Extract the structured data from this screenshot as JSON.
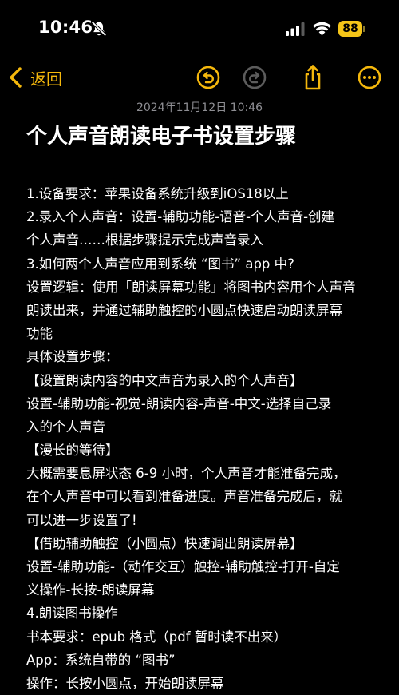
{
  "status_bar": {
    "time": "10:46",
    "battery_level": "88",
    "icons": [
      "bell-slash-icon",
      "signal-icon",
      "wifi-icon",
      "battery-icon"
    ]
  },
  "nav": {
    "back_label": "返回",
    "accent_color": "#f5b80c",
    "icons": [
      "chevron-left-icon",
      "undo-icon",
      "redo-icon",
      "share-icon",
      "more-icon"
    ]
  },
  "note": {
    "date": "2024年11月12日 10:46",
    "title": "个人声音朗读电子书设置步骤",
    "lines": [
      "1.设备要求：苹果设备系统升级到iOS18以上",
      "2.录入个人声音：设置-辅助功能-语音-个人声音-创建",
      "个人声音……根据步骤提示完成声音录入",
      "3.如何两个人声音应用到系统 “图书” app 中?",
      "设置逻辑：使用「朗读屏幕功能」将图书内容用个人声音",
      "朗读出来，并通过辅助触控的小圆点快速启动朗读屏幕",
      "功能",
      "具体设置步骤：",
      "【设置朗读内容的中文声音为录入的个人声音】",
      "设置-辅助功能-视觉-朗读内容-声音-中文-选择自己录",
      "入的个人声音",
      "【漫长的等待】",
      "大概需要息屏状态 6-9 小时，个人声音才能准备完成，",
      "在个人声音中可以看到准备进度。声音准备完成后，就",
      "可以进一步设置了!",
      "【借助辅助触控（小圆点）快速调出朗读屏幕】",
      "设置-辅助功能-（动作交互）触控-辅助触控-打开-自定",
      "义操作-长按-朗读屏幕",
      "4.朗读图书操作",
      "书本要求：epub 格式（pdf 暂时读不出来）",
      "App：系统自带的 “图书”",
      "操作：长按小圆点，开始朗读屏幕"
    ]
  }
}
